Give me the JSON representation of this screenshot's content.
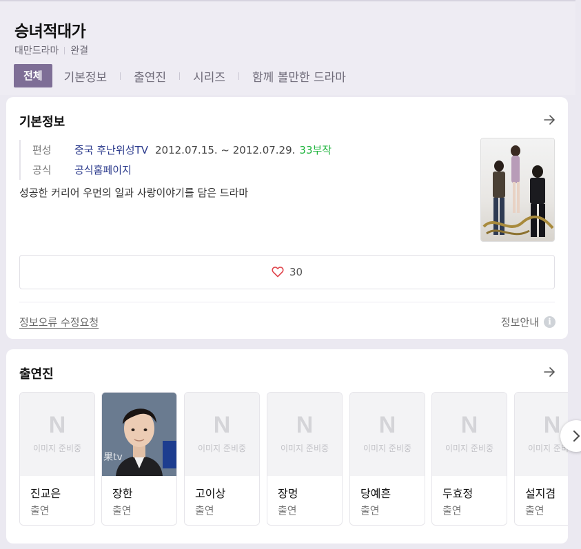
{
  "header": {
    "title": "승녀적대가",
    "genre": "대만드라마",
    "status": "완결",
    "tabs": [
      {
        "label": "전체"
      },
      {
        "label": "기본정보"
      },
      {
        "label": "출연진"
      },
      {
        "label": "시리즈"
      },
      {
        "label": "함께 볼만한 드라마"
      }
    ]
  },
  "basic_info": {
    "title": "기본정보",
    "rows": {
      "channel_key": "편성",
      "channel_value": "중국 후난위성TV",
      "period": "2012.07.15. ~ 2012.07.29.",
      "episodes": "33부작",
      "site_key": "공식",
      "site_value": "공식홈페이지"
    },
    "description": "성공한 커리어 우먼의 일과 사랑이야기를 담은 드라마",
    "like_count": "30",
    "report_label": "정보오류 수정요청",
    "guide_label": "정보안내"
  },
  "cast": {
    "title": "출연진",
    "placeholder_logo": "N",
    "placeholder_text": "이미지 준비중",
    "members": [
      {
        "name": "진교은",
        "role": "출연"
      },
      {
        "name": "장한",
        "role": "출연"
      },
      {
        "name": "고이상",
        "role": "출연"
      },
      {
        "name": "장멍",
        "role": "출연"
      },
      {
        "name": "당예흔",
        "role": "출연"
      },
      {
        "name": "두효정",
        "role": "출연"
      },
      {
        "name": "설지겸",
        "role": "출연"
      }
    ]
  },
  "colors": {
    "accent": "#7e6e96",
    "link": "#2b3a8c",
    "green": "#1eb43c",
    "heart": "#e0454c"
  },
  "icons": [
    "arrow-right-icon",
    "heart-icon",
    "info-icon",
    "chevron-right-icon"
  ]
}
